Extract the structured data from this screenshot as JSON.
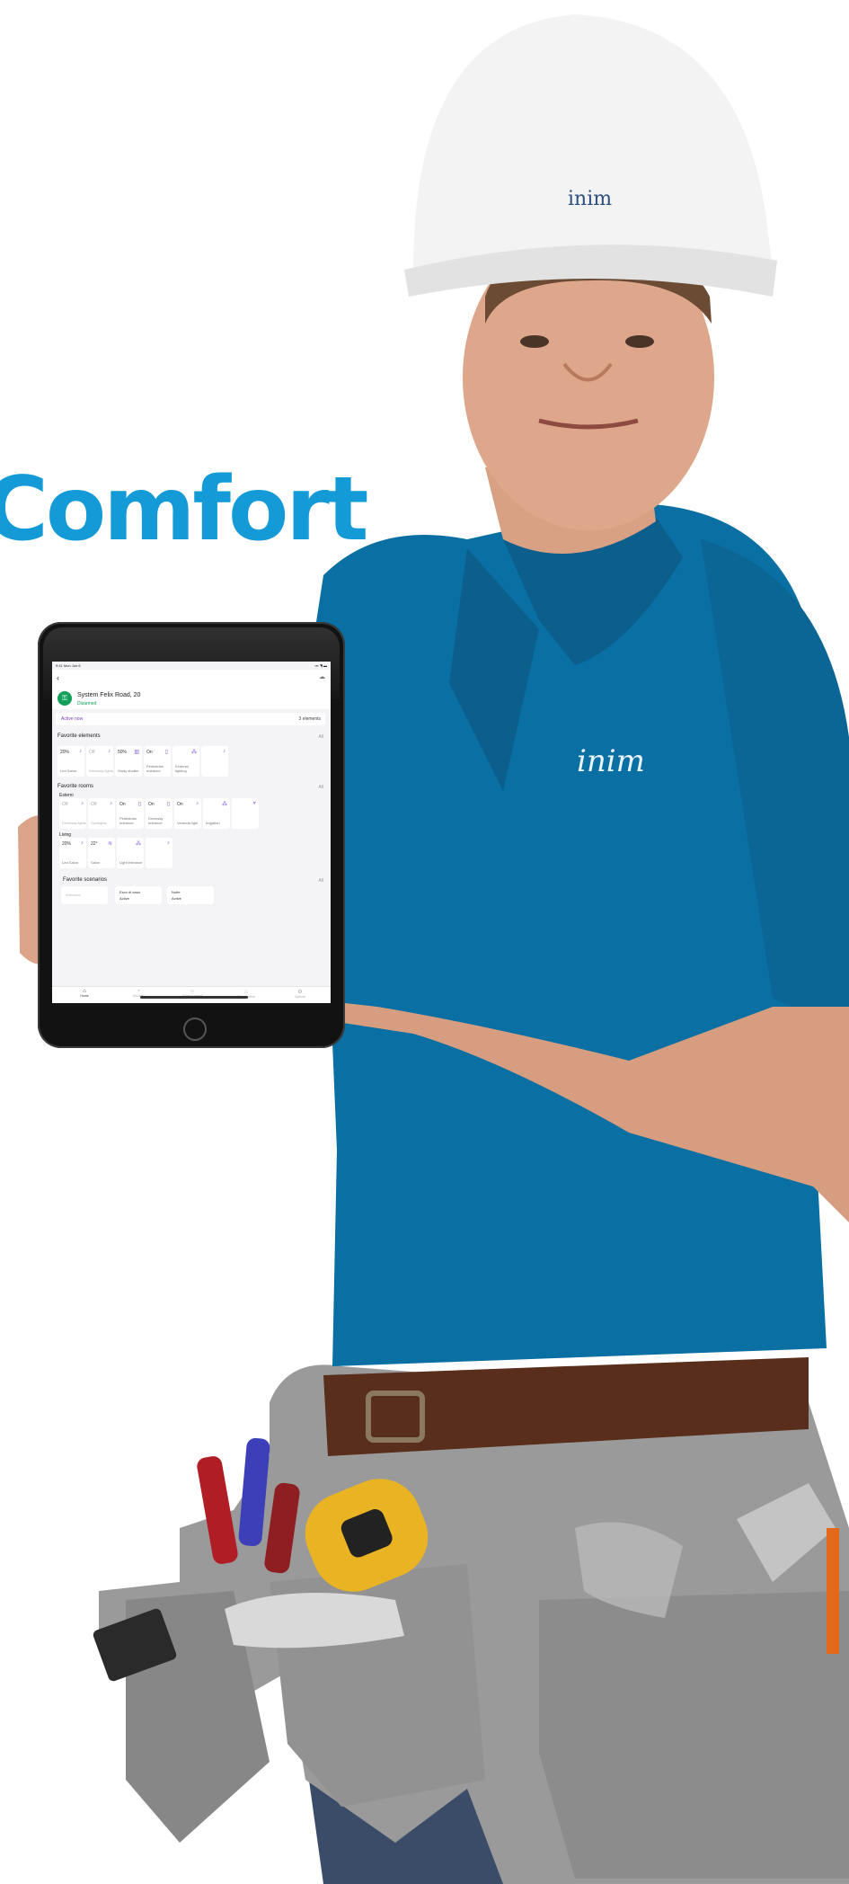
{
  "headline": "Comfort",
  "brand": {
    "helmet_logo": "inim",
    "shirt_logo": "inim"
  },
  "colors": {
    "headline": "#149bd7",
    "shirt": "#0a6fa3",
    "armed_green": "#11a05a",
    "accent_purple": "#7a3fc4"
  },
  "app": {
    "status_time": "9:41 Mon Jun 6",
    "status_right": "▪▪▪ ◥ ▬",
    "back_icon": "‹",
    "cloud_icon": "☁",
    "system_name": "System Felix Road, 20",
    "system_status": "Disarmed",
    "active_label": "Active now",
    "active_count": "3 elements",
    "favorite_elements": {
      "title": "Favorite elements",
      "all": "All",
      "tiles": [
        {
          "value": "20%",
          "icon": "♪",
          "name": "Led Salon",
          "dim": false
        },
        {
          "value": "Off",
          "icon": "♪",
          "name": "Driveway lights",
          "dim": true
        },
        {
          "value": "50%",
          "icon": "▥",
          "name": "Study shutter",
          "dim": false
        },
        {
          "value": "On",
          "icon": "▯",
          "name": "Pedestrian entrance",
          "dim": false
        },
        {
          "value": "",
          "icon": "⁂",
          "name": "External lighting",
          "dim": false
        },
        {
          "value": "",
          "icon": "♪",
          "name": "",
          "dim": false
        }
      ]
    },
    "favorite_rooms": {
      "title": "Favorite rooms",
      "all": "All",
      "rooms": [
        {
          "name": "Esterni",
          "tiles": [
            {
              "value": "Off",
              "icon": "♪",
              "name": "Driveway lights",
              "dim": true
            },
            {
              "value": "Off",
              "icon": "♪",
              "name": "Spotlights",
              "dim": true
            },
            {
              "value": "On",
              "icon": "▯",
              "name": "Pedestrian entrance",
              "dim": false
            },
            {
              "value": "On",
              "icon": "▯",
              "name": "Driveway entrance",
              "dim": false
            },
            {
              "value": "On",
              "icon": "♪",
              "name": "Veranda light",
              "dim": false
            },
            {
              "value": "",
              "icon": "⁂",
              "name": "Irrigation",
              "dim": false
            },
            {
              "value": "",
              "icon": "⩔",
              "name": "",
              "dim": false
            }
          ]
        },
        {
          "name": "Living",
          "tiles": [
            {
              "value": "20%",
              "icon": "♪",
              "name": "Led Salon",
              "dim": false
            },
            {
              "value": "22°",
              "icon": "≋",
              "name": "Salon",
              "dim": false
            },
            {
              "value": "",
              "icon": "⁂",
              "name": "Light entrance",
              "dim": false
            },
            {
              "value": "",
              "icon": "♪",
              "name": "",
              "dim": false
            }
          ]
        }
      ]
    },
    "favorite_scenarios": {
      "title": "Favorite scenarios",
      "all": "All",
      "items": [
        {
          "name": "Welcome",
          "status": "",
          "dim": true
        },
        {
          "name": "Esco di casa",
          "status": "Active",
          "dim": false
        },
        {
          "name": "Notte",
          "status": "Active",
          "dim": false
        }
      ]
    },
    "tabs": [
      {
        "icon": "⌂",
        "label": "Home",
        "on": true
      },
      {
        "icon": "◔",
        "label": "Security",
        "on": false
      },
      {
        "icon": "⌂",
        "label": "Home Comfort",
        "on": false
      },
      {
        "icon": "♨",
        "label": "Climatisation",
        "on": false
      },
      {
        "icon": "⚙",
        "label": "Special",
        "on": false
      }
    ]
  }
}
